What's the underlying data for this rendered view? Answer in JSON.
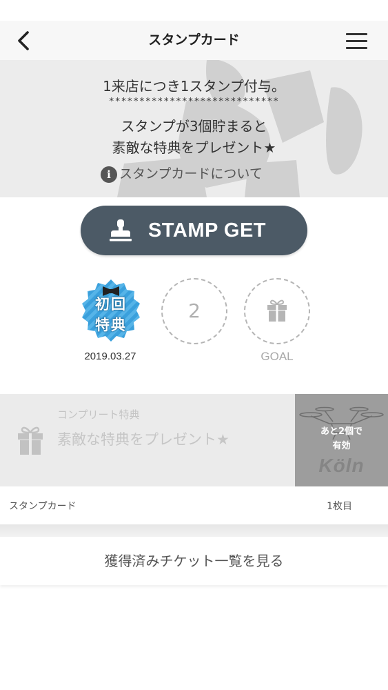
{
  "nav": {
    "back_icon": "chevron-left-icon",
    "title": "スタンプカード",
    "menu_icon": "hamburger-menu-icon"
  },
  "hero": {
    "line1": "1来店につき1スタンプ付与。",
    "stars": "****************************",
    "line2": "スタンプが3個貯まると",
    "line3": "素敵な特典をプレゼント★",
    "about_icon": "info-icon",
    "about_icon_glyph": "i",
    "about_link": "スタンプカードについて"
  },
  "stamp_button": {
    "icon": "stamp-icon",
    "label": "STAMP GET",
    "color": "#4c5a66"
  },
  "stamps": [
    {
      "type": "badge",
      "badge_text_line1": "初回",
      "badge_text_line2": "特典",
      "date": "2019.03.27",
      "badge_color": "#3aa0dc"
    },
    {
      "type": "empty",
      "number": "2"
    },
    {
      "type": "goal",
      "icon": "gift-icon",
      "label": "GOAL"
    }
  ],
  "complete": {
    "icon": "gift-icon",
    "sub_label": "コンプリート特典",
    "title": "素敵な特典をプレゼント★",
    "reward_line1": "あと2個で",
    "reward_line2": "有効",
    "reward_logo": "Köln"
  },
  "card_footer": {
    "label": "スタンプカード",
    "count": "1枚目"
  },
  "tickets_link": "獲得済みチケット一覧を見る"
}
